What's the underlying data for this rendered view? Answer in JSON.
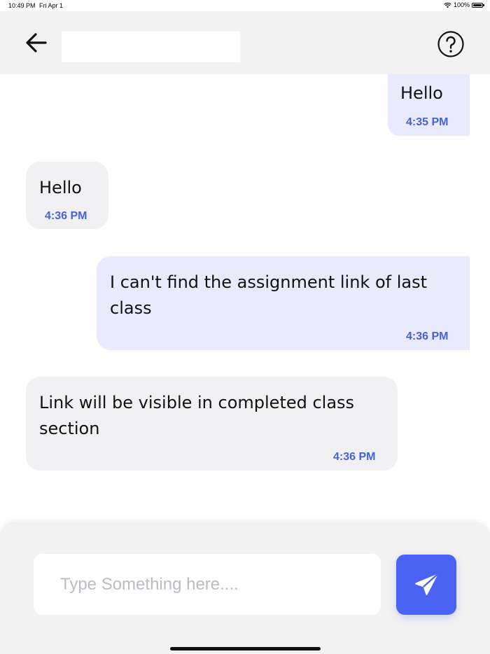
{
  "status_bar": {
    "time": "10:49 PM",
    "date": "Fri Apr 1",
    "battery_percent_label": "100%",
    "battery_level": 1.0
  },
  "header": {
    "title": "",
    "back_icon": "arrow-left-icon",
    "help_icon": "question-circle-icon"
  },
  "messages": [
    {
      "direction": "sent",
      "text": "Hello",
      "time": "4:35 PM"
    },
    {
      "direction": "received",
      "text": "Hello",
      "time": "4:36 PM"
    },
    {
      "direction": "sent",
      "text": "I can't find the assignment link of last class",
      "time": "4:36 PM"
    },
    {
      "direction": "received",
      "text": "Link will be visible in completed class section",
      "time": "4:36 PM"
    }
  ],
  "composer": {
    "input_value": "",
    "placeholder": "Type Something here....",
    "send_icon": "paper-plane-icon"
  },
  "colors": {
    "accent": "#4a63f5",
    "timestamp": "#4561d8",
    "sent_bubble": "#e9ebfc",
    "received_bubble": "#f1f1f3",
    "header_bg": "#f2f2f3"
  }
}
